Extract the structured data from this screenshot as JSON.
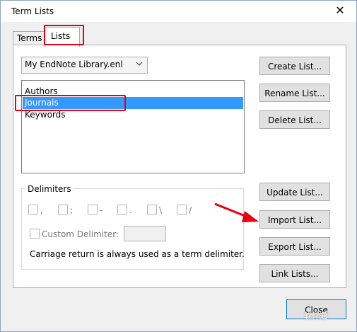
{
  "window": {
    "title": "Term Lists",
    "close_glyph": "✕"
  },
  "tabs": [
    {
      "label": "Terms"
    },
    {
      "label": "Lists"
    }
  ],
  "library_select": {
    "value": "My EndNote Library.enl"
  },
  "lists": [
    {
      "label": "Authors"
    },
    {
      "label": "Journals",
      "selected": true
    },
    {
      "label": "Keywords"
    }
  ],
  "buttons": {
    "create": "Create List...",
    "rename": "Rename List...",
    "delete": "Delete List...",
    "update": "Update List...",
    "import": "Import List...",
    "export": "Export List...",
    "link": "Link Lists...",
    "close": "Close"
  },
  "delimiters": {
    "label": "Delimiters",
    "options": [
      ",",
      ";",
      "-",
      ".",
      "\\",
      "/"
    ],
    "custom_label": "Custom Delimiter:",
    "note": "Carriage return is always used as a term delimiter."
  },
  "annotations": {
    "highlight_color": "#e60012"
  },
  "watermark": {
    "text": "软件通"
  },
  "colors": {
    "selection": "#3399ff",
    "accent_border": "#0078d7"
  }
}
